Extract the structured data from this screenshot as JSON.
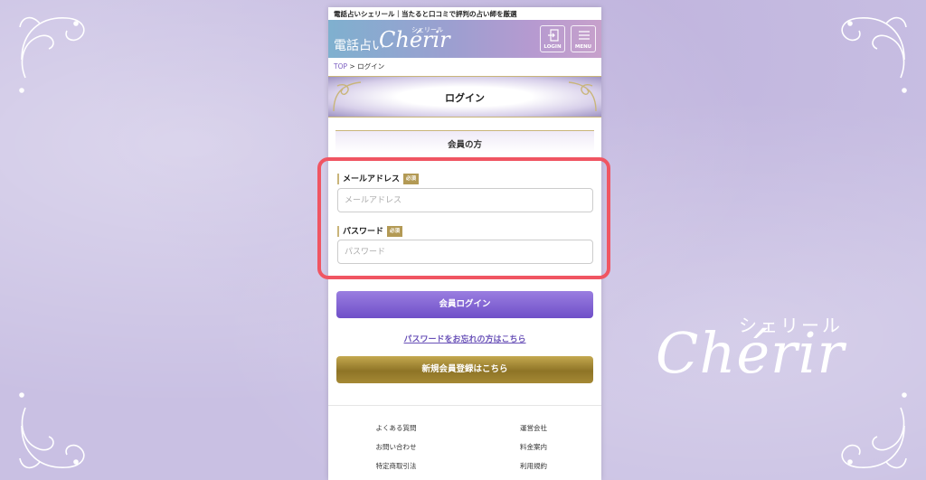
{
  "colors": {
    "background": "#c9c0e3",
    "accent_purple": "#6f4fc8",
    "accent_gold": "#8e7426",
    "highlight": "#f05562"
  },
  "page": {
    "tagline": "電話占いシェリール｜当たると口コミで評判の占い師を厳選",
    "logo_jp": "電話占い",
    "logo_latin": "Chérir",
    "logo_kana": "シェリール",
    "login_label": "LOGIN",
    "menu_label": "MENU"
  },
  "breadcrumb": {
    "top": "TOP",
    "separator": ">",
    "current": "ログイン"
  },
  "title": "ログイン",
  "section_title": "会員の方",
  "form": {
    "email_label": "メールアドレス",
    "email_required": "必須",
    "email_placeholder": "メールアドレス",
    "email_value": "",
    "password_label": "パスワード",
    "password_required": "必須",
    "password_placeholder": "パスワード",
    "password_value": ""
  },
  "buttons": {
    "login": "会員ログイン",
    "forgot": "パスワードをお忘れの方はこちら",
    "register": "新規会員登録はこちら"
  },
  "footer": {
    "col1": [
      "よくある質問",
      "お問い合わせ",
      "特定商取引法"
    ],
    "col2": [
      "運営会社",
      "料金案内",
      "利用規約"
    ]
  },
  "brand_big": {
    "kana": "シェリール",
    "latin": "Chérir"
  },
  "icons": [
    "login-door-icon",
    "hamburger-menu-icon",
    "corner-ornament-icon"
  ]
}
